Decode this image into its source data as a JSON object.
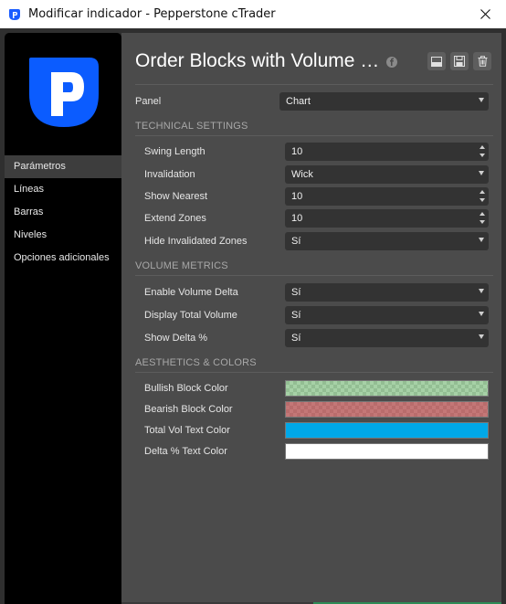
{
  "window": {
    "title": "Modificar indicador - Pepperstone cTrader"
  },
  "sidebar": {
    "items": [
      {
        "label": "Parámetros",
        "active": true
      },
      {
        "label": "Líneas"
      },
      {
        "label": "Barras"
      },
      {
        "label": "Niveles"
      },
      {
        "label": "Opciones adicionales"
      }
    ]
  },
  "header": {
    "title": "Order Blocks with Volume Metrics"
  },
  "panel": {
    "label": "Panel",
    "value": "Chart"
  },
  "technical": {
    "title": "TECHNICAL SETTINGS",
    "swing_length": {
      "label": "Swing Length",
      "value": "10"
    },
    "invalidation": {
      "label": "Invalidation",
      "value": "Wick"
    },
    "show_nearest": {
      "label": "Show Nearest",
      "value": "10"
    },
    "extend_zones": {
      "label": "Extend Zones",
      "value": "10"
    },
    "hide_invalidated": {
      "label": "Hide Invalidated Zones",
      "value": "Sí"
    }
  },
  "volume": {
    "title": "VOLUME METRICS",
    "enable_delta": {
      "label": "Enable Volume Delta",
      "value": "Sí"
    },
    "display_total": {
      "label": "Display Total Volume",
      "value": "Sí"
    },
    "show_delta_pct": {
      "label": "Show Delta %",
      "value": "Sí"
    }
  },
  "aesthetics": {
    "title": "AESTHETICS & COLORS",
    "bullish": {
      "label": "Bullish Block Color",
      "color": "#5fbf5f",
      "opacity": 0.45
    },
    "bearish": {
      "label": "Bearish Block Color",
      "color": "#b84a4a",
      "opacity": 0.7
    },
    "total_vol": {
      "label": "Total Vol Text Color",
      "color": "#00a8e8"
    },
    "delta_pct": {
      "label": "Delta % Text Color",
      "color": "#ffffff"
    }
  },
  "colors": {
    "brand_blue": "#0b5cff",
    "sidebar_bg": "#000000",
    "panel_bg": "#4b4b4b",
    "control_bg": "#333333"
  }
}
